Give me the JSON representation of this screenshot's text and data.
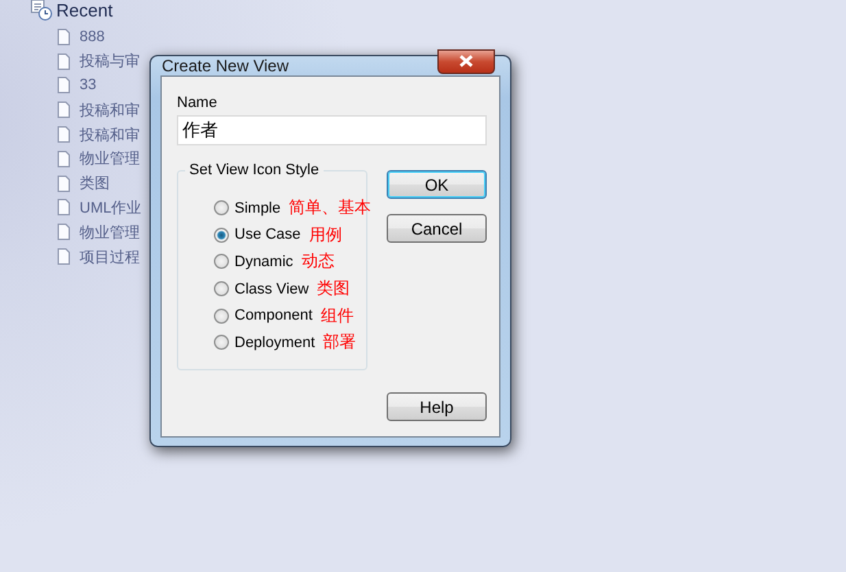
{
  "recent": {
    "title": "Recent",
    "items": [
      "888",
      "投稿与审",
      "33",
      "投稿和审",
      "投稿和审",
      "物业管理",
      "类图",
      "UML作业",
      "物业管理",
      "项目过程"
    ]
  },
  "dialog": {
    "title": "Create New View",
    "name_label": "Name",
    "name_value": "作者",
    "group_title": "Set View Icon Style",
    "options": [
      {
        "label": "Simple",
        "annotation": "简单、基本",
        "selected": false
      },
      {
        "label": "Use Case",
        "annotation": "用例",
        "selected": true
      },
      {
        "label": "Dynamic",
        "annotation": "动态",
        "selected": false
      },
      {
        "label": "Class View",
        "annotation": "类图",
        "selected": false
      },
      {
        "label": "Component",
        "annotation": "组件",
        "selected": false
      },
      {
        "label": "Deployment",
        "annotation": "部署",
        "selected": false
      }
    ],
    "buttons": [
      "OK",
      "Cancel",
      "Help"
    ]
  }
}
